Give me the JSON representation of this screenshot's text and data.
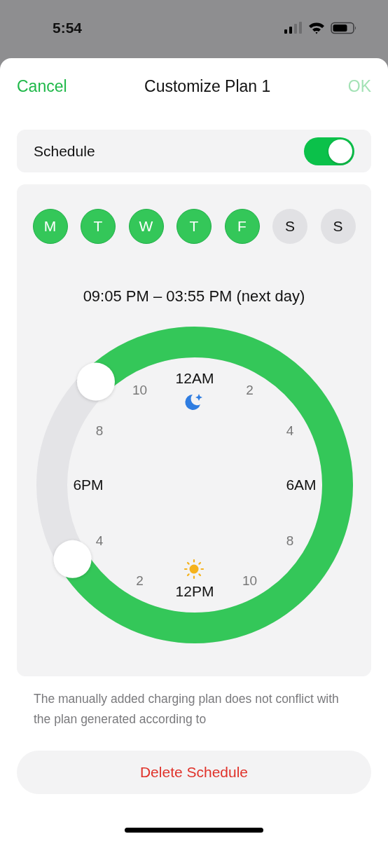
{
  "status_bar": {
    "time": "5:54"
  },
  "header": {
    "cancel": "Cancel",
    "title": "Customize Plan 1",
    "ok": {
      "label": "OK",
      "disabled": true
    }
  },
  "schedule": {
    "label": "Schedule",
    "on": true
  },
  "days": [
    {
      "label": "M",
      "selected": true
    },
    {
      "label": "T",
      "selected": true
    },
    {
      "label": "W",
      "selected": true
    },
    {
      "label": "T",
      "selected": true
    },
    {
      "label": "F",
      "selected": true
    },
    {
      "label": "S",
      "selected": false
    },
    {
      "label": "S",
      "selected": false
    }
  ],
  "time_range": "09:05 PM – 03:55 PM (next day)",
  "dial": {
    "hour_labels": [
      {
        "text": "12AM",
        "kind": "major"
      },
      {
        "text": "10",
        "kind": "minor"
      },
      {
        "text": "2",
        "kind": "minor"
      },
      {
        "text": "8",
        "kind": "minor"
      },
      {
        "text": "4",
        "kind": "minor"
      },
      {
        "text": "6PM",
        "kind": "major"
      },
      {
        "text": "6AM",
        "kind": "major"
      },
      {
        "text": "4",
        "kind": "minor"
      },
      {
        "text": "8",
        "kind": "minor"
      },
      {
        "text": "2",
        "kind": "minor"
      },
      {
        "text": "10",
        "kind": "minor"
      },
      {
        "text": "12PM",
        "kind": "major"
      }
    ]
  },
  "note": "The manually added charging plan does not conflict with the plan generated according to",
  "delete_button": "Delete Schedule"
}
